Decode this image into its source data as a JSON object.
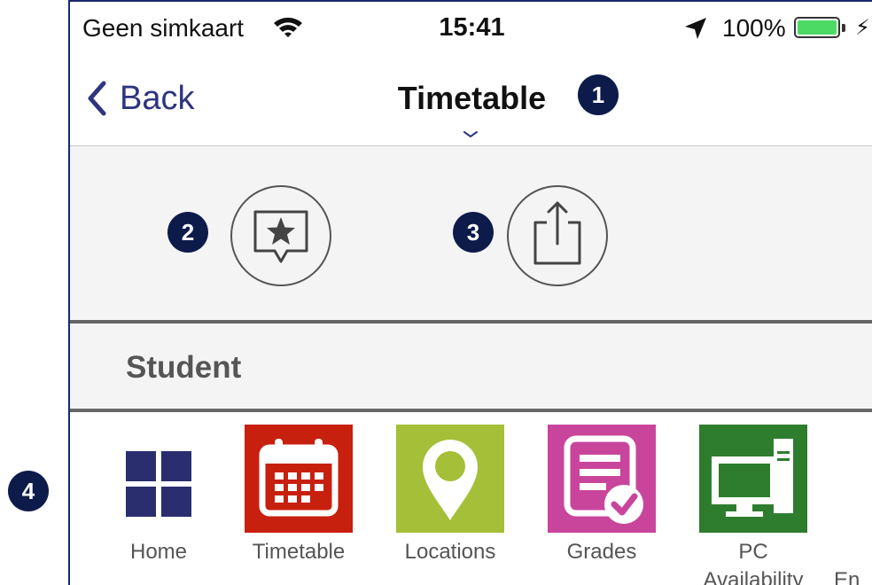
{
  "status_bar": {
    "carrier": "Geen simkaart",
    "time": "15:41",
    "battery_percent": "100%",
    "battery_level": 1.0,
    "battery_color": "#4cd964"
  },
  "nav": {
    "back_label": "Back",
    "title": "Timetable",
    "accent": "#2e3580"
  },
  "actions": [
    {
      "name": "favorite",
      "icon": "star-speech-bubble-icon"
    },
    {
      "name": "share",
      "icon": "share-icon"
    }
  ],
  "section": {
    "title": "Student"
  },
  "tiles": [
    {
      "label": "Home",
      "icon": "grid-icon",
      "color": "#2a2d6e"
    },
    {
      "label": "Timetable",
      "icon": "calendar-icon",
      "color": "#c8200e"
    },
    {
      "label": "Locations",
      "icon": "map-pin-icon",
      "color": "#a5bf38"
    },
    {
      "label": "Grades",
      "icon": "grades-document-icon",
      "color": "#c9459c"
    },
    {
      "label_line1": "PC",
      "label_line2": "Availability",
      "icon": "computer-icon",
      "color": "#2e7d2e"
    },
    {
      "label": "En"
    }
  ],
  "annotations": [
    "1",
    "2",
    "3",
    "4"
  ]
}
